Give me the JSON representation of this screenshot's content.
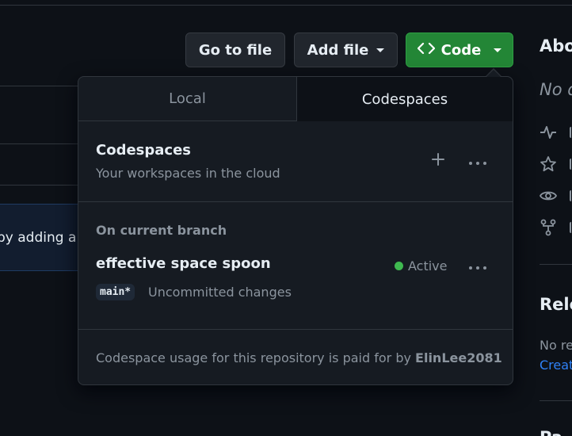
{
  "toolbar": {
    "go_to_file": "Go to file",
    "add_file": "Add file",
    "code": "Code"
  },
  "background": {
    "banner_text": "by adding a"
  },
  "sidebar": {
    "about_title": "Abo",
    "about_desc": "No d",
    "releases_title": "Rele",
    "no_releases": "No re",
    "create_link": "Creat",
    "packages_title": "Pa"
  },
  "dropdown": {
    "tabs": [
      "Local",
      "Codespaces"
    ],
    "active_tab": "Codespaces",
    "section_title": "Codespaces",
    "section_subtitle": "Your workspaces in the cloud",
    "branch_label": "On current branch",
    "codespace": {
      "name": "effective space spoon",
      "status": "Active",
      "status_color": "#3fb950",
      "branch": "main*",
      "changes": "Uncommitted changes"
    },
    "footer_prefix": "Codespace usage for this repository is paid for by",
    "footer_owner": "ElinLee2081"
  },
  "colors": {
    "code_button": "#238636",
    "link": "#2f81f7"
  },
  "icons": [
    "code-icon",
    "plus-icon",
    "kebab-horizontal-icon",
    "pulse-icon",
    "star-icon",
    "eye-icon",
    "repo-forked-icon"
  ]
}
